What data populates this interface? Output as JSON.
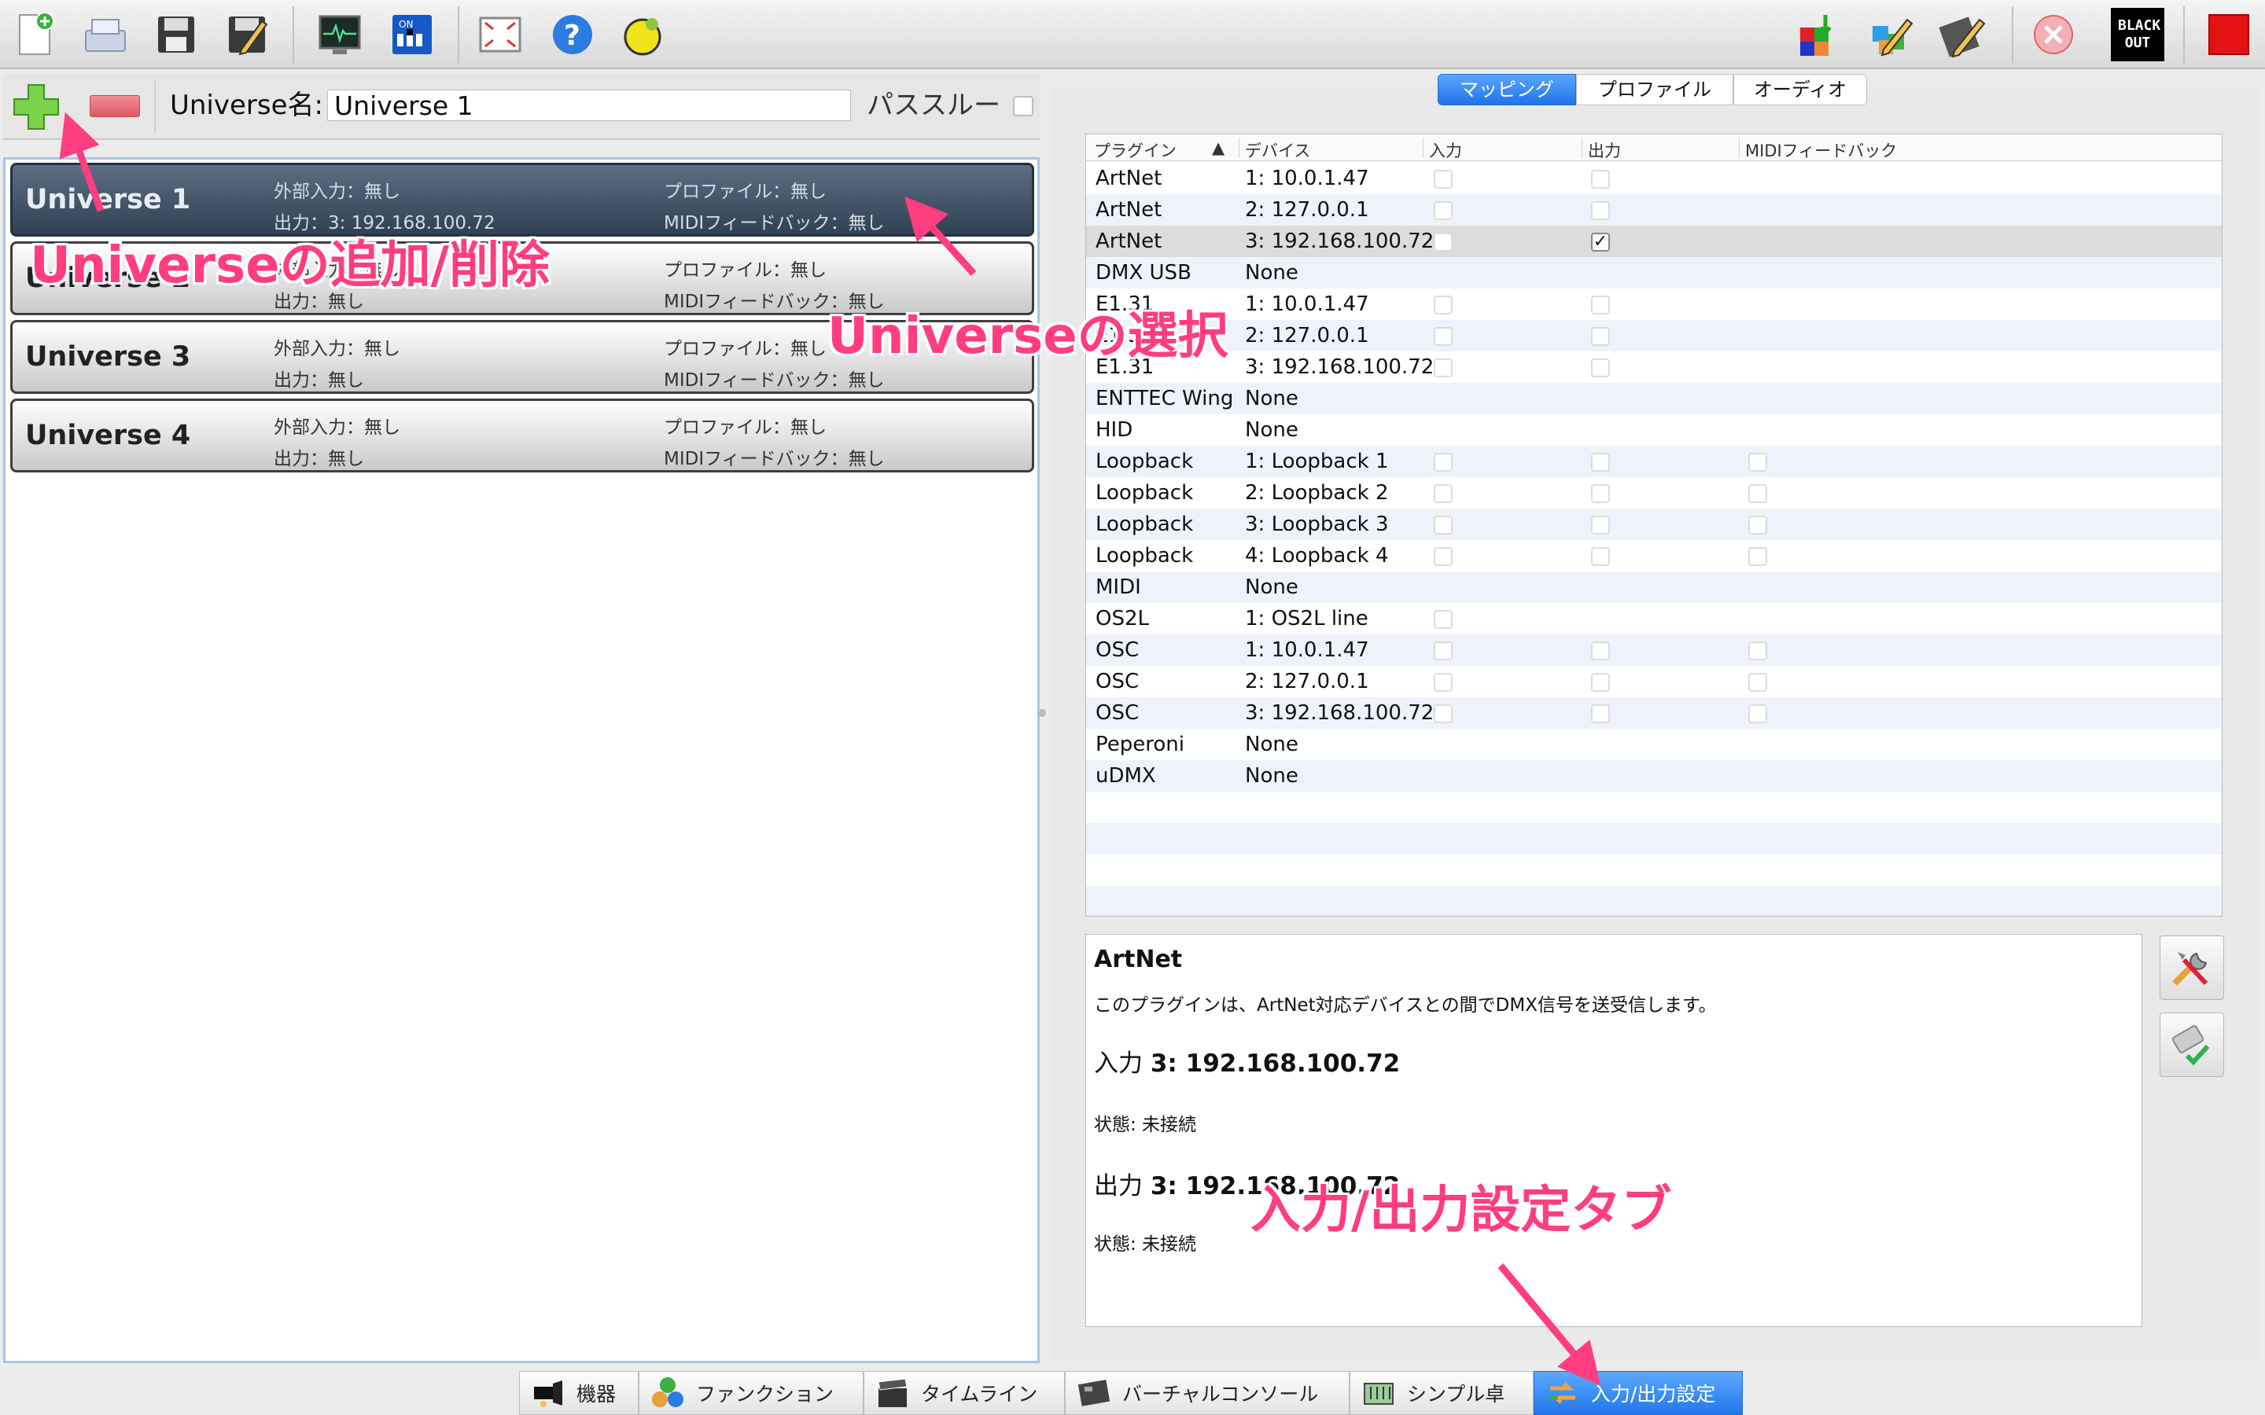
{
  "toolbar": {
    "left_icons": [
      "new-workspace-icon",
      "open-workspace-icon",
      "save-workspace-icon",
      "save-as-icon",
      "monitor-icon",
      "address-tool-icon",
      "fullscreen-icon",
      "help-icon",
      "about-icon"
    ],
    "right_icons": [
      "live-edit-icon",
      "design-mode-icon",
      "edit-mode-icon",
      "stop-all-icon",
      "blackout-icon",
      "operate-mode-icon"
    ],
    "blackout_label": "BLACK OUT"
  },
  "universe_panel": {
    "name_label": "Universe名:",
    "name_value": "Universe 1",
    "passthrough_label": "パススルー",
    "items": [
      {
        "name": "Universe 1",
        "input_label": "外部入力：",
        "input_value": "無し",
        "output_label": "出力：",
        "output_value": "3: 192.168.100.72",
        "profile_label": "プロファイル：",
        "profile_value": "無し",
        "feedback_label": "MIDIフィードバック：",
        "feedback_value": "無し"
      },
      {
        "name": "Universe 2",
        "input_label": "外部入力：",
        "input_value": "無し",
        "output_label": "出力：",
        "output_value": "無し",
        "profile_label": "プロファイル：",
        "profile_value": "無し",
        "feedback_label": "MIDIフィードバック：",
        "feedback_value": "無し"
      },
      {
        "name": "Universe 3",
        "input_label": "外部入力：",
        "input_value": "無し",
        "output_label": "出力：",
        "output_value": "無し",
        "profile_label": "プロファイル：",
        "profile_value": "無し",
        "feedback_label": "MIDIフィードバック：",
        "feedback_value": "無し"
      },
      {
        "name": "Universe 4",
        "input_label": "外部入力：",
        "input_value": "無し",
        "output_label": "出力：",
        "output_value": "無し",
        "profile_label": "プロファイル：",
        "profile_value": "無し",
        "feedback_label": "MIDIフィードバック：",
        "feedback_value": "無し"
      }
    ]
  },
  "right_tabs": [
    "マッピング",
    "プロファイル",
    "オーディオ"
  ],
  "mapping_table": {
    "headers": [
      "プラグイン",
      "デバイス",
      "入力",
      "出力",
      "MIDIフィードバック"
    ],
    "sort_indicator": "▲",
    "rows": [
      {
        "plugin": "ArtNet",
        "device": "1: 10.0.1.47",
        "in": "off",
        "out": "off",
        "fb": "none"
      },
      {
        "plugin": "ArtNet",
        "device": "2: 127.0.0.1",
        "in": "off",
        "out": "off",
        "fb": "none"
      },
      {
        "plugin": "ArtNet",
        "device": "3: 192.168.100.72",
        "in": "off",
        "out": "on",
        "fb": "none"
      },
      {
        "plugin": "DMX USB",
        "device": "None",
        "in": "none",
        "out": "none",
        "fb": "none"
      },
      {
        "plugin": "E1.31",
        "device": "1: 10.0.1.47",
        "in": "off",
        "out": "off",
        "fb": "none"
      },
      {
        "plugin": "E1.31",
        "device": "2: 127.0.0.1",
        "in": "off",
        "out": "off",
        "fb": "none"
      },
      {
        "plugin": "E1.31",
        "device": "3: 192.168.100.72",
        "in": "off",
        "out": "off",
        "fb": "none"
      },
      {
        "plugin": "ENTTEC Wing",
        "device": "None",
        "in": "none",
        "out": "none",
        "fb": "none"
      },
      {
        "plugin": "HID",
        "device": "None",
        "in": "none",
        "out": "none",
        "fb": "none"
      },
      {
        "plugin": "Loopback",
        "device": "1: Loopback 1",
        "in": "off",
        "out": "off",
        "fb": "off"
      },
      {
        "plugin": "Loopback",
        "device": "2: Loopback 2",
        "in": "off",
        "out": "off",
        "fb": "off"
      },
      {
        "plugin": "Loopback",
        "device": "3: Loopback 3",
        "in": "off",
        "out": "off",
        "fb": "off"
      },
      {
        "plugin": "Loopback",
        "device": "4: Loopback 4",
        "in": "off",
        "out": "off",
        "fb": "off"
      },
      {
        "plugin": "MIDI",
        "device": "None",
        "in": "none",
        "out": "none",
        "fb": "none"
      },
      {
        "plugin": "OS2L",
        "device": "1: OS2L line",
        "in": "off",
        "out": "none",
        "fb": "none"
      },
      {
        "plugin": "OSC",
        "device": "1: 10.0.1.47",
        "in": "off",
        "out": "off",
        "fb": "off"
      },
      {
        "plugin": "OSC",
        "device": "2: 127.0.0.1",
        "in": "off",
        "out": "off",
        "fb": "off"
      },
      {
        "plugin": "OSC",
        "device": "3: 192.168.100.72",
        "in": "off",
        "out": "off",
        "fb": "off"
      },
      {
        "plugin": "Peperoni",
        "device": "None",
        "in": "none",
        "out": "none",
        "fb": "none"
      },
      {
        "plugin": "uDMX",
        "device": "None",
        "in": "none",
        "out": "none",
        "fb": "none"
      }
    ]
  },
  "info_panel": {
    "title": "ArtNet",
    "description": "このプラグインは、ArtNet対応デバイスとの間でDMX信号を送受信します。",
    "input_label": "入力",
    "input_value": "3: 192.168.100.72",
    "input_status": "状態: 未接続",
    "output_label": "出力",
    "output_value": "3: 192.168.100.72",
    "output_status": "状態: 未接続"
  },
  "bottom_tabs": [
    {
      "label": "機器",
      "icon": "fixture-icon"
    },
    {
      "label": "ファンクション",
      "icon": "function-icon"
    },
    {
      "label": "タイムライン",
      "icon": "clapperboard-icon"
    },
    {
      "label": "バーチャルコンソール",
      "icon": "virtual-console-icon"
    },
    {
      "label": "シンプル卓",
      "icon": "simple-desk-icon"
    },
    {
      "label": "入力/出力設定",
      "icon": "io-arrows-icon"
    }
  ],
  "annotations": {
    "add_remove": "Universeの追加/削除",
    "select": "Universeの選択",
    "io_tab": "入力/出力設定タブ"
  },
  "colors": {
    "accent": "#2177ea",
    "annotation": "#ff3d7f",
    "selected_universe": "#3a4d60"
  }
}
